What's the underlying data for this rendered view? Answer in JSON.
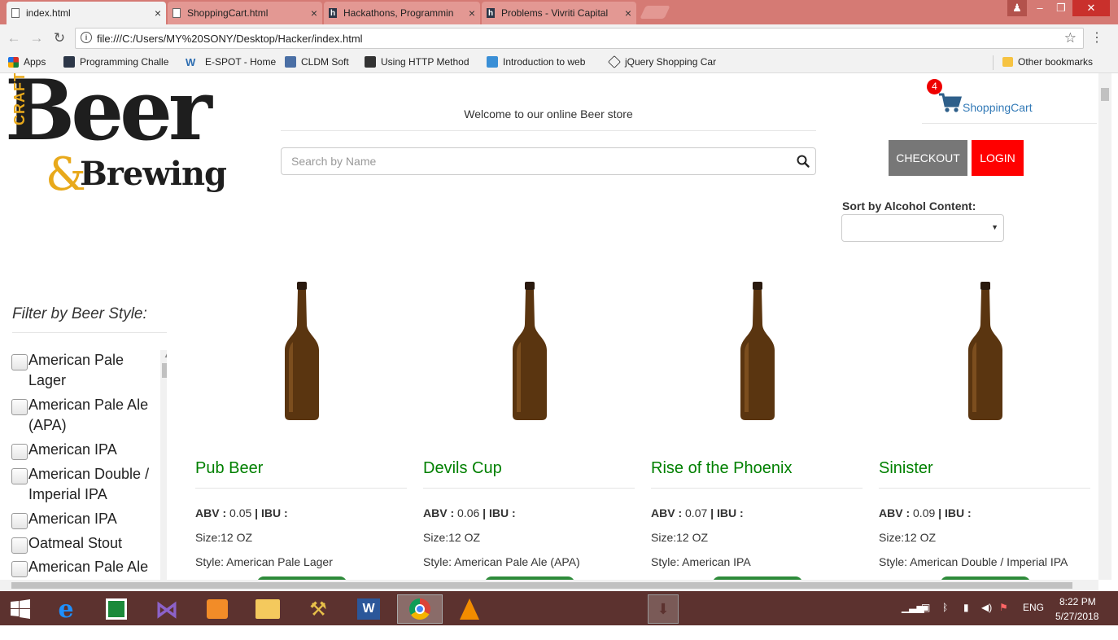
{
  "browser": {
    "tabs": [
      {
        "title": "index.html",
        "icon": "page-icon",
        "active": true
      },
      {
        "title": "ShoppingCart.html",
        "icon": "page-icon",
        "active": false
      },
      {
        "title": "Hackathons, Programmin",
        "icon": "hackerrank-icon",
        "active": false
      },
      {
        "title": "Problems - Vivriti Capital",
        "icon": "hackerrank-icon",
        "active": false
      }
    ],
    "url": "file:///C:/Users/MY%20SONY/Desktop/Hacker/index.html",
    "bookmarks": [
      {
        "label": "Apps",
        "icon": "apps-grid-icon",
        "color": "#d93025"
      },
      {
        "label": "Programming Challe",
        "icon": "hackerrank-icon",
        "color": "#2d3748"
      },
      {
        "label": "E-SPOT - Home",
        "icon": "w-icon",
        "color": "#2b6cb0"
      },
      {
        "label": "CLDM Soft",
        "icon": "cldm-icon",
        "color": "#4a6fa5"
      },
      {
        "label": "Using HTTP Method",
        "icon": "doc-icon",
        "color": "#333333"
      },
      {
        "label": "Introduction to web",
        "icon": "bird-icon",
        "color": "#3a8fd6"
      },
      {
        "label": "jQuery Shopping Car",
        "icon": "codepen-icon",
        "color": "#222222"
      }
    ],
    "other_bookmarks": "Other bookmarks"
  },
  "header": {
    "logo_craft": "CRAFT",
    "logo_beer": "Beer",
    "logo_amp": "&",
    "logo_brewing": "Brewing",
    "welcome": "Welcome to our online Beer store",
    "search_placeholder": "Search by Name",
    "cart_count": "4",
    "cart_label": "ShoppingCart",
    "checkout_label": "CHECKOUT",
    "login_label": "LOGIN",
    "sort_label": "Sort by Alcohol Content:",
    "sort_value": ""
  },
  "filter": {
    "title": "Filter by Beer Style:",
    "items": [
      {
        "label": "American Pale Lager"
      },
      {
        "label": "American Pale Ale (APA)"
      },
      {
        "label": "American IPA"
      },
      {
        "label": "American Double / Imperial IPA"
      },
      {
        "label": "American IPA"
      },
      {
        "label": "Oatmeal Stout"
      },
      {
        "label": "American Pale Ale"
      }
    ]
  },
  "products": [
    {
      "name": "Pub Beer",
      "abv_label": "ABV :",
      "abv": "0.05",
      "ibu_label": "| IBU :",
      "size": "Size:12 OZ",
      "style": "Style: American Pale Lager"
    },
    {
      "name": "Devils Cup",
      "abv_label": "ABV :",
      "abv": "0.06",
      "ibu_label": "| IBU :",
      "size": "Size:12 OZ",
      "style": "Style: American Pale Ale (APA)"
    },
    {
      "name": "Rise of the Phoenix",
      "abv_label": "ABV :",
      "abv": "0.07",
      "ibu_label": "| IBU :",
      "size": "Size:12 OZ",
      "style": "Style: American IPA"
    },
    {
      "name": "Sinister",
      "abv_label": "ABV :",
      "abv": "0.09",
      "ibu_label": "| IBU :",
      "size": "Size:12 OZ",
      "style": "Style: American Double / Imperial IPA"
    }
  ],
  "taskbar": {
    "apps": [
      "start-icon",
      "ie-icon",
      "store-icon",
      "visual-studio-icon",
      "media-player-icon",
      "file-explorer-icon",
      "tools-icon",
      "word-icon",
      "chrome-icon",
      "vlc-icon"
    ],
    "lang": "ENG",
    "time": "8:22 PM",
    "date": "5/27/2018"
  },
  "colors": {
    "product_name": "#008000",
    "checkout_bg": "#777777",
    "login_bg": "#ff0000",
    "cart_badge": "#ee0000",
    "tab_bar": "#d57a74",
    "taskbar": "#5c322f"
  }
}
